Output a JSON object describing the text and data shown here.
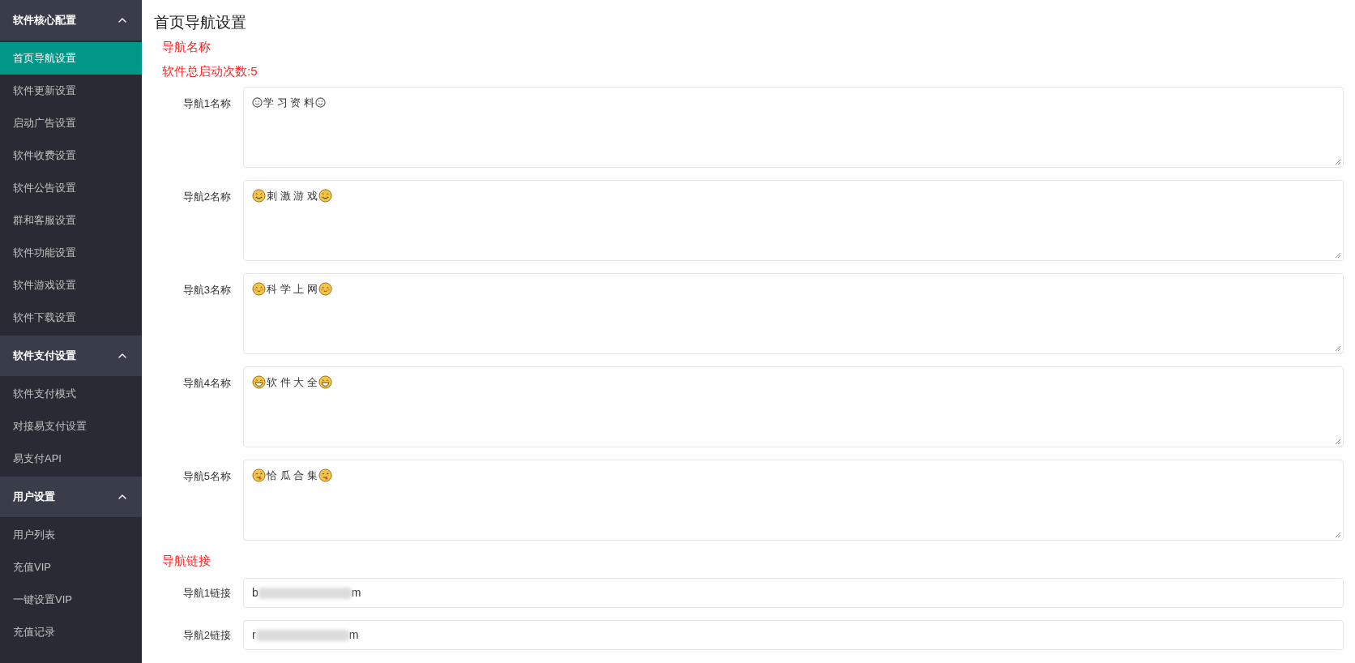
{
  "sidebar": {
    "groups": [
      {
        "title": "软件核心配置",
        "expanded": true,
        "items": [
          {
            "label": "首页导航设置",
            "selected": true
          },
          {
            "label": "软件更新设置",
            "selected": false
          },
          {
            "label": "启动广告设置",
            "selected": false
          },
          {
            "label": "软件收费设置",
            "selected": false
          },
          {
            "label": "软件公告设置",
            "selected": false
          },
          {
            "label": "群和客服设置",
            "selected": false
          },
          {
            "label": "软件功能设置",
            "selected": false
          },
          {
            "label": "软件游戏设置",
            "selected": false
          },
          {
            "label": "软件下载设置",
            "selected": false
          }
        ]
      },
      {
        "title": "软件支付设置",
        "expanded": true,
        "items": [
          {
            "label": "软件支付模式",
            "selected": false
          },
          {
            "label": "对接易支付设置",
            "selected": false
          },
          {
            "label": "易支付API",
            "selected": false
          }
        ]
      },
      {
        "title": "用户设置",
        "expanded": true,
        "items": [
          {
            "label": "用户列表",
            "selected": false
          },
          {
            "label": "充值VIP",
            "selected": false
          },
          {
            "label": "一键设置VIP",
            "selected": false
          },
          {
            "label": "充值记录",
            "selected": false
          }
        ]
      }
    ]
  },
  "page_title": "首页导航设置",
  "names_section": {
    "heading": "导航名称",
    "launch_count": "软件总启动次数:5",
    "fields": [
      {
        "label": "导航1名称",
        "value": "学 习 资 料",
        "kind": "outline"
      },
      {
        "label": "导航2名称",
        "value": "刺 激 游 戏",
        "kind": "smile"
      },
      {
        "label": "导航3名称",
        "value": "科 学 上 网",
        "kind": "blush"
      },
      {
        "label": "导航4名称",
        "value": "软 件 大 全",
        "kind": "grin"
      },
      {
        "label": "导航5名称",
        "value": "恰 瓜 合 集",
        "kind": "wink"
      }
    ]
  },
  "links_section": {
    "heading": "导航链接",
    "fields": [
      {
        "label": "导航1链接",
        "value_start": "b",
        "value_end": "m"
      },
      {
        "label": "导航2链接",
        "value_start": "r",
        "value_end": "m"
      }
    ]
  }
}
